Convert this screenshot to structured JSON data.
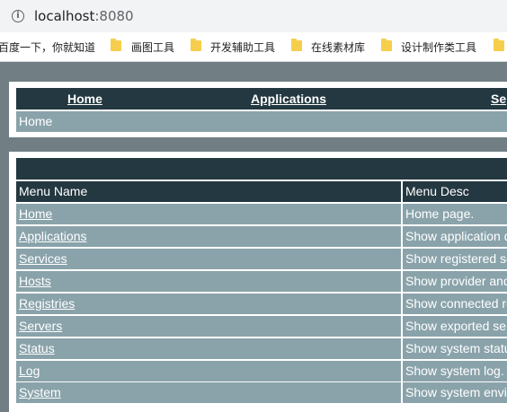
{
  "browser": {
    "url_host": "localhost",
    "url_port": ":8080",
    "bookmarks": [
      "百度一下，你就知道",
      "画图工具",
      "开发辅助工具",
      "在线素材库",
      "设计制作类工具"
    ]
  },
  "nav": {
    "links": [
      "Home",
      "Applications",
      "Se"
    ],
    "breadcrumb": "Home"
  },
  "table": {
    "headers": [
      "Menu Name",
      "Menu Desc"
    ],
    "rows": [
      {
        "name": "Home",
        "desc": "Home page."
      },
      {
        "name": "Applications",
        "desc": "Show application d"
      },
      {
        "name": "Services",
        "desc": "Show registered se"
      },
      {
        "name": "Hosts",
        "desc": "Show provider and"
      },
      {
        "name": "Registries",
        "desc": "Show connected re"
      },
      {
        "name": "Servers",
        "desc": "Show exported ser"
      },
      {
        "name": "Status",
        "desc": "Show system statu"
      },
      {
        "name": "Log",
        "desc": "Show system log."
      },
      {
        "name": "System",
        "desc": "Show system envi"
      }
    ]
  },
  "colors": {
    "dark": "#233840",
    "row": "#8aa3ab",
    "page_bg": "#717f85",
    "folder": "#f6ce4b"
  }
}
